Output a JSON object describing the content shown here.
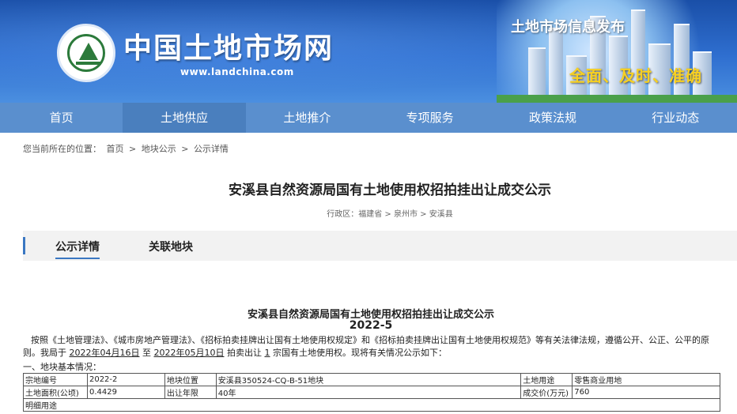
{
  "header": {
    "site_title": "中国土地市场网",
    "site_url": "www.landchina.com",
    "promo_title": "土地市场信息发布",
    "promo_slogan": "全面、及时、准确"
  },
  "nav": {
    "items": [
      "首页",
      "土地供应",
      "土地推介",
      "专项服务",
      "政策法规",
      "行业动态"
    ]
  },
  "breadcrumb": {
    "prefix": "您当前所在的位置：",
    "home": "首页",
    "sep1": ">",
    "notice": "地块公示",
    "sep2": ">",
    "current": "公示详情"
  },
  "page": {
    "title": "安溪县自然资源局国有土地使用权招拍挂出让成交公示",
    "region": "行政区：福建省 > 泉州市 > 安溪县"
  },
  "tabs": {
    "detail": "公示详情",
    "related": "关联地块"
  },
  "document": {
    "title": "安溪县自然资源局国有土地使用权招拍挂出让成交公示",
    "year": "2022-5",
    "para_part1": "按照《土地管理法》、《城市房地产管理法》、《招标拍卖挂牌出让国有土地使用权规定》和《招标拍卖挂牌出让国有土地使用权规范》等有关法律法规，遵循公开、公正、公平的原则。我局于 ",
    "date_start": "2022年04月16日",
    "para_part2": " 至 ",
    "date_end": "2022年05月10日",
    "para_part3": " 拍卖出让 ",
    "count": "1",
    "para_part4": " 宗国有土地使用权。现将有关情况公示如下：",
    "section1": "一、地块基本情况："
  },
  "table": {
    "r1": [
      "宗地编号",
      "2022-2",
      "地块位置",
      "安溪县350524-CQ-B-51地块",
      "土地用途",
      "零售商业用地"
    ],
    "r2": [
      "土地面积(公顷)",
      "0.4429",
      "出让年限",
      "40年",
      "成交价(万元)",
      "760"
    ],
    "r3": [
      "明细用途"
    ]
  }
}
